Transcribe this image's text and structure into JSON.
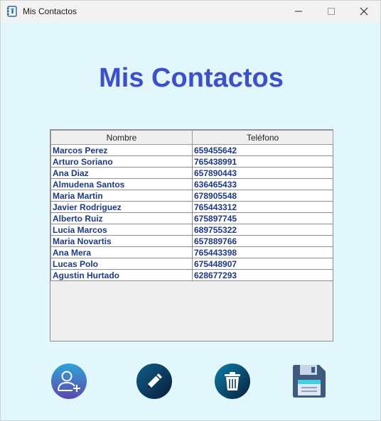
{
  "window": {
    "title": "Mis Contactos",
    "minimize_label": "—",
    "maximize_label": "☐",
    "close_label": "✕"
  },
  "main": {
    "heading": "Mis Contactos"
  },
  "table": {
    "columns": [
      "Nombre",
      "Teléfono"
    ],
    "rows": [
      [
        "Marcos Perez",
        "659455642"
      ],
      [
        "Arturo Soriano",
        "765438991"
      ],
      [
        "Ana Diaz",
        "657890443"
      ],
      [
        "Almudena Santos",
        "636465433"
      ],
      [
        "Maria Martin",
        "678905548"
      ],
      [
        "Javier Rodriguez",
        "765443312"
      ],
      [
        "Alberto Ruiz",
        "675897745"
      ],
      [
        "Lucia Marcos",
        "689755322"
      ],
      [
        "Maria Novartis",
        "657889766"
      ],
      [
        "Ana Mera",
        "765443398"
      ],
      [
        "Lucas Polo",
        "675448907"
      ],
      [
        "Agustin Hurtado",
        "628677293"
      ]
    ]
  },
  "toolbar": {
    "buttons": [
      {
        "name": "add-contact-button",
        "icon": "add-user-icon"
      },
      {
        "name": "edit-contact-button",
        "icon": "pencil-icon"
      },
      {
        "name": "delete-contact-button",
        "icon": "trash-icon"
      },
      {
        "name": "save-button",
        "icon": "floppy-disk-icon"
      }
    ]
  },
  "colors": {
    "background": "#e2f7fb",
    "heading": "#3d4fd0",
    "cell_text": "#1c3a8a"
  }
}
